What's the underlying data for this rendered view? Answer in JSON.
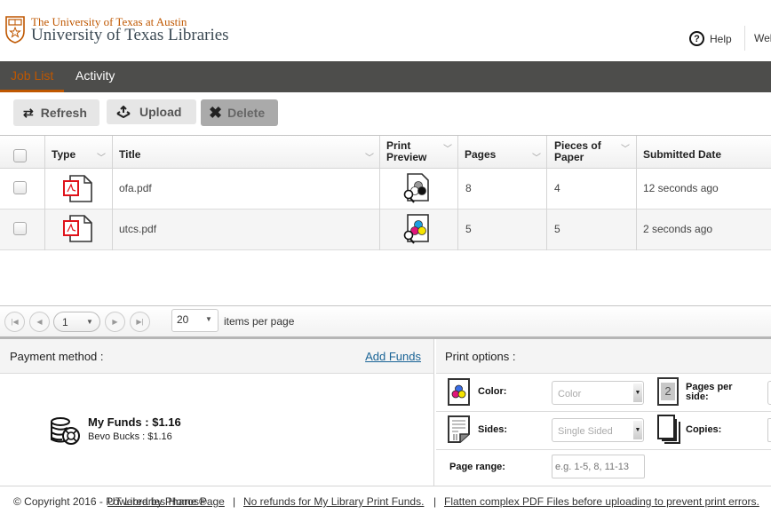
{
  "header": {
    "university": "The University of Texas at Austin",
    "libraries": "University of Texas Libraries",
    "help_label": "Help",
    "welcome_label": "Wel"
  },
  "nav": {
    "tabs": [
      {
        "label": "Job List",
        "active": true
      },
      {
        "label": "Activity",
        "active": false
      }
    ]
  },
  "toolbar": {
    "refresh_label": "Refresh",
    "upload_label": "Upload",
    "delete_label": "Delete"
  },
  "grid": {
    "columns": [
      "Type",
      "Title",
      "Print Preview",
      "Pages",
      "Pieces of Paper",
      "Submitted Date"
    ],
    "column_lines": {
      "print": "Print",
      "preview": "Preview",
      "pieces": "Pieces of",
      "paper": "Paper"
    },
    "rows": [
      {
        "type": "pdf",
        "title": "ofa.pdf",
        "preview": "grayscale",
        "pages": "8",
        "pieces": "4",
        "submitted": "12 seconds ago"
      },
      {
        "type": "pdf",
        "title": "utcs.pdf",
        "preview": "color",
        "pages": "5",
        "pieces": "5",
        "submitted": "2 seconds ago"
      }
    ]
  },
  "pager": {
    "current_page": "1",
    "per_page": "20",
    "per_page_label": "items per page"
  },
  "payment": {
    "title": "Payment method :",
    "add_funds": "Add Funds",
    "my_funds": "My Funds : $1.16",
    "bevo_bucks": "Bevo Bucks : $1.16"
  },
  "print_options": {
    "title": "Print options :",
    "color_label": "Color:",
    "color_value": "Color",
    "pages_per_side_line1": "Pages per",
    "pages_per_side_line2": "side:",
    "pages_per_side_glyph": "2",
    "sides_label": "Sides:",
    "sides_value": "Single Sided",
    "copies_label": "Copies:",
    "page_range_label": "Page range:",
    "page_range_placeholder": "e.g. 1-5, 8, 11-13"
  },
  "footer": {
    "copyright": "© Copyright 2016 - Powered by Pharos®",
    "home_link": "UT Libraries Home Page",
    "sep": "|",
    "refund_link": "No refunds for My Library Print Funds.",
    "flatten_link": "Flatten complex PDF Files before uploading to prevent print errors."
  },
  "colors": {
    "accent": "#bf5700",
    "nav_bg": "#4d4d4b",
    "link": "#1a6496"
  }
}
